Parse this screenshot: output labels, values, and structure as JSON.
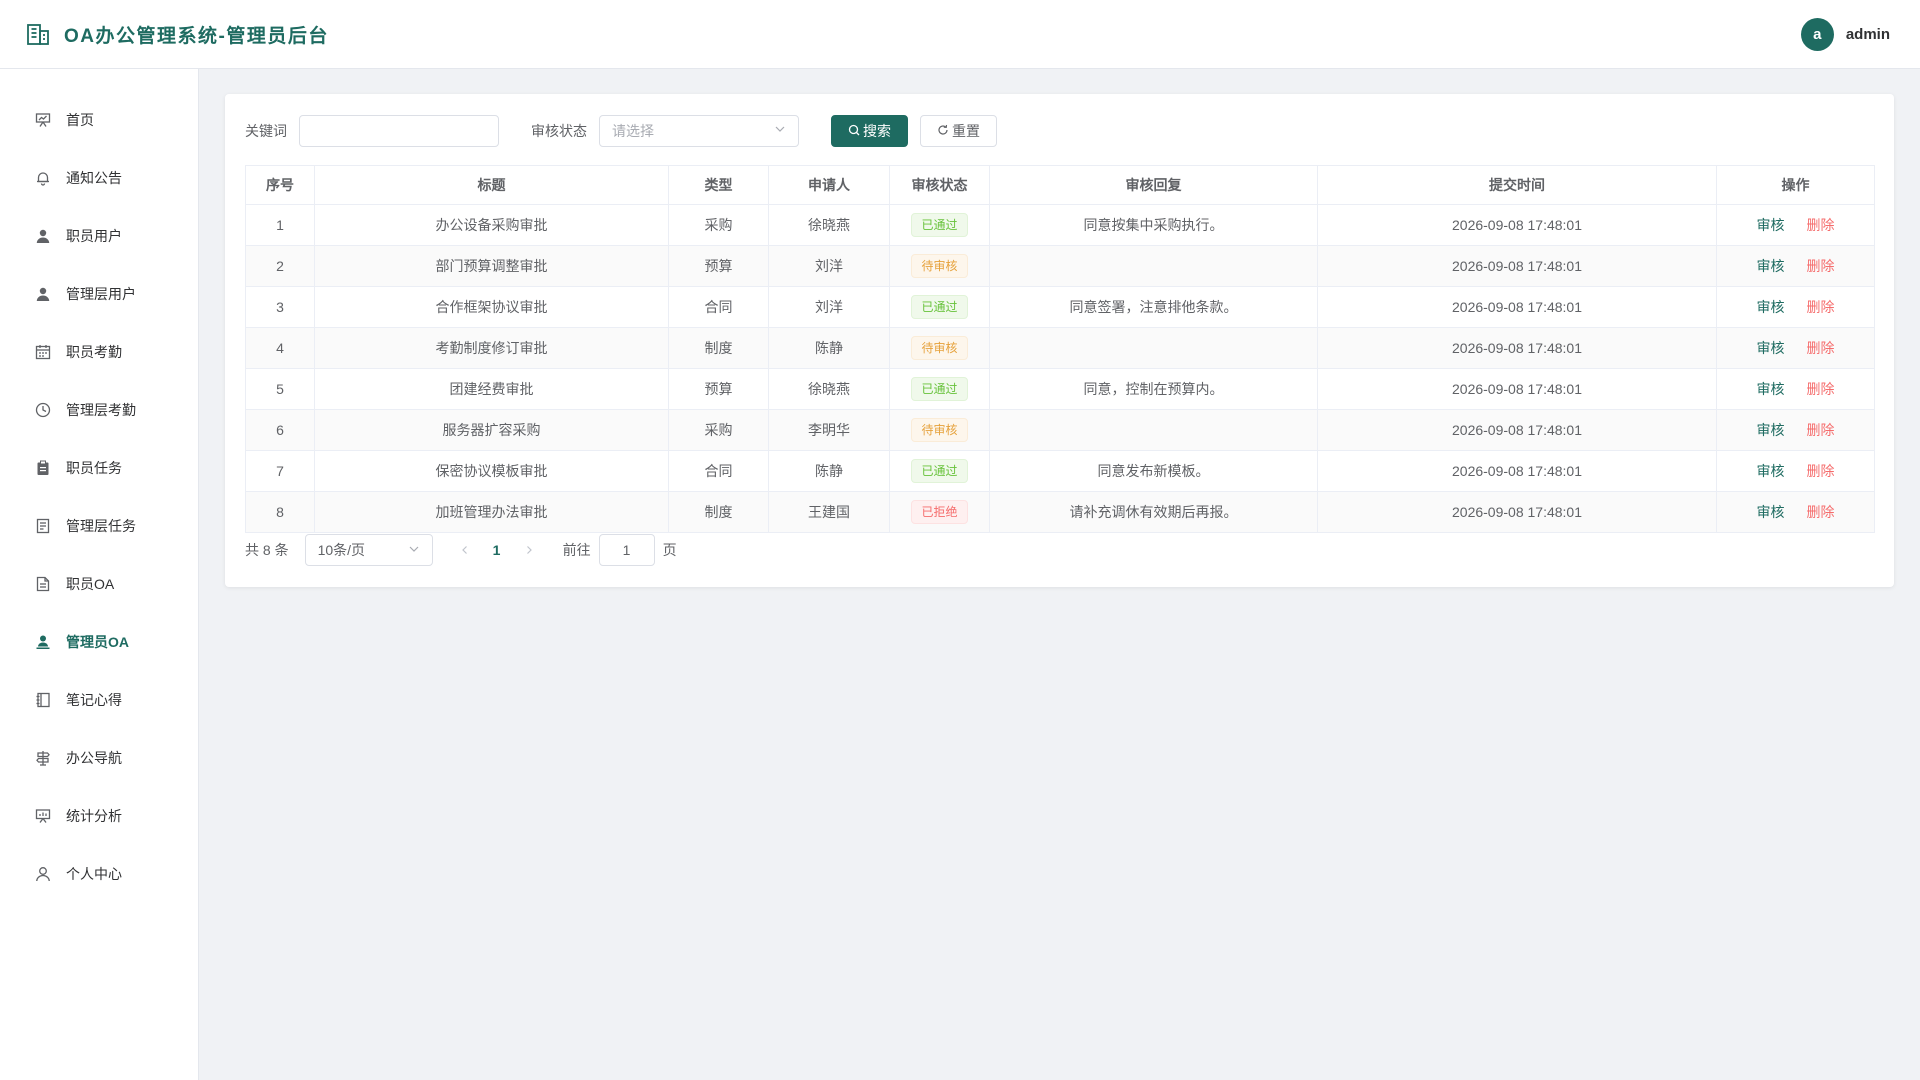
{
  "header": {
    "title": "OA办公管理系统-管理员后台",
    "avatar_letter": "a",
    "username": "admin",
    "brand_color": "#1e6b61"
  },
  "sidebar": {
    "items": [
      {
        "label": "首页",
        "icon": "presentation-icon",
        "active": false
      },
      {
        "label": "通知公告",
        "icon": "bell-icon",
        "active": false
      },
      {
        "label": "职员用户",
        "icon": "user-filled-icon",
        "active": false
      },
      {
        "label": "管理层用户",
        "icon": "user-filled-icon",
        "active": false
      },
      {
        "label": "职员考勤",
        "icon": "calendar-icon",
        "active": false
      },
      {
        "label": "管理层考勤",
        "icon": "clock-icon",
        "active": false
      },
      {
        "label": "职员任务",
        "icon": "clipboard-icon",
        "active": false
      },
      {
        "label": "管理层任务",
        "icon": "tickets-icon",
        "active": false
      },
      {
        "label": "职员OA",
        "icon": "document-icon",
        "active": false
      },
      {
        "label": "管理员OA",
        "icon": "avatar-icon",
        "active": true
      },
      {
        "label": "笔记心得",
        "icon": "notebook-icon",
        "active": false
      },
      {
        "label": "办公导航",
        "icon": "guide-icon",
        "active": false
      },
      {
        "label": "统计分析",
        "icon": "data-board-icon",
        "active": false
      },
      {
        "label": "个人中心",
        "icon": "user-outline-icon",
        "active": false
      }
    ]
  },
  "filters": {
    "keyword_label": "关键词",
    "keyword_value": "",
    "keyword_placeholder": "",
    "status_label": "审核状态",
    "status_placeholder": "请选择",
    "search_label": "搜索",
    "reset_label": "重置"
  },
  "table": {
    "columns": [
      "序号",
      "标题",
      "类型",
      "申请人",
      "审核状态",
      "审核回复",
      "提交时间",
      "操作"
    ],
    "audit_label": "审核",
    "delete_label": "删除",
    "rows": [
      {
        "no": "1",
        "title": "办公设备采购审批",
        "type": "采购",
        "applicant": "徐晓燕",
        "status": "已通过",
        "status_kind": "success",
        "reply": "同意按集中采购执行。",
        "time": "2026-09-08 17:48:01"
      },
      {
        "no": "2",
        "title": "部门预算调整审批",
        "type": "预算",
        "applicant": "刘洋",
        "status": "待审核",
        "status_kind": "warning",
        "reply": "",
        "time": "2026-09-08 17:48:01"
      },
      {
        "no": "3",
        "title": "合作框架协议审批",
        "type": "合同",
        "applicant": "刘洋",
        "status": "已通过",
        "status_kind": "success",
        "reply": "同意签署，注意排他条款。",
        "time": "2026-09-08 17:48:01"
      },
      {
        "no": "4",
        "title": "考勤制度修订审批",
        "type": "制度",
        "applicant": "陈静",
        "status": "待审核",
        "status_kind": "warning",
        "reply": "",
        "time": "2026-09-08 17:48:01"
      },
      {
        "no": "5",
        "title": "团建经费审批",
        "type": "预算",
        "applicant": "徐晓燕",
        "status": "已通过",
        "status_kind": "success",
        "reply": "同意，控制在预算内。",
        "time": "2026-09-08 17:48:01"
      },
      {
        "no": "6",
        "title": "服务器扩容采购",
        "type": "采购",
        "applicant": "李明华",
        "status": "待审核",
        "status_kind": "warning",
        "reply": "",
        "time": "2026-09-08 17:48:01"
      },
      {
        "no": "7",
        "title": "保密协议模板审批",
        "type": "合同",
        "applicant": "陈静",
        "status": "已通过",
        "status_kind": "success",
        "reply": "同意发布新模板。",
        "time": "2026-09-08 17:48:01"
      },
      {
        "no": "8",
        "title": "加班管理办法审批",
        "type": "制度",
        "applicant": "王建国",
        "status": "已拒绝",
        "status_kind": "danger",
        "reply": "请补充调休有效期后再报。",
        "time": "2026-09-08 17:48:01"
      }
    ]
  },
  "status_colors": {
    "success": {
      "text": "#67c23a",
      "bg": "#f0f9eb",
      "border": "#e1f3d8"
    },
    "warning": {
      "text": "#e6a23c",
      "bg": "#fdf6ec",
      "border": "#faecd8"
    },
    "danger": {
      "text": "#f56c6c",
      "bg": "#fef0f0",
      "border": "#fde2e2"
    }
  },
  "pagination": {
    "total_text": "共 8 条",
    "page_size": "10条/页",
    "current_page": "1",
    "goto_label": "前往",
    "goto_value": "1",
    "page_suffix": "页"
  }
}
